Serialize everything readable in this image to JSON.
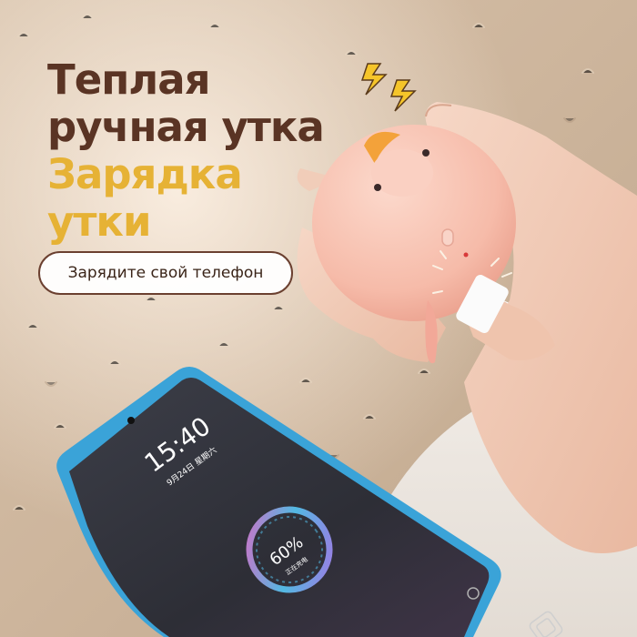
{
  "headline": {
    "line1": "Теплая",
    "line2": "ручная утка",
    "line3": "Зарядка",
    "line4": "утки"
  },
  "cta_pill": "Зарядите свой телефон",
  "phone_screen": {
    "time": "15:40",
    "date": "9月24日 星期六",
    "battery_percent": "60%",
    "charging_label": "正在充电"
  },
  "colors": {
    "headline_dark": "#5a3424",
    "headline_gold": "#e6b235",
    "duck_body": "#f7c2b2",
    "duck_beak": "#f3a23a",
    "charge_ring": "#56c8f5"
  }
}
